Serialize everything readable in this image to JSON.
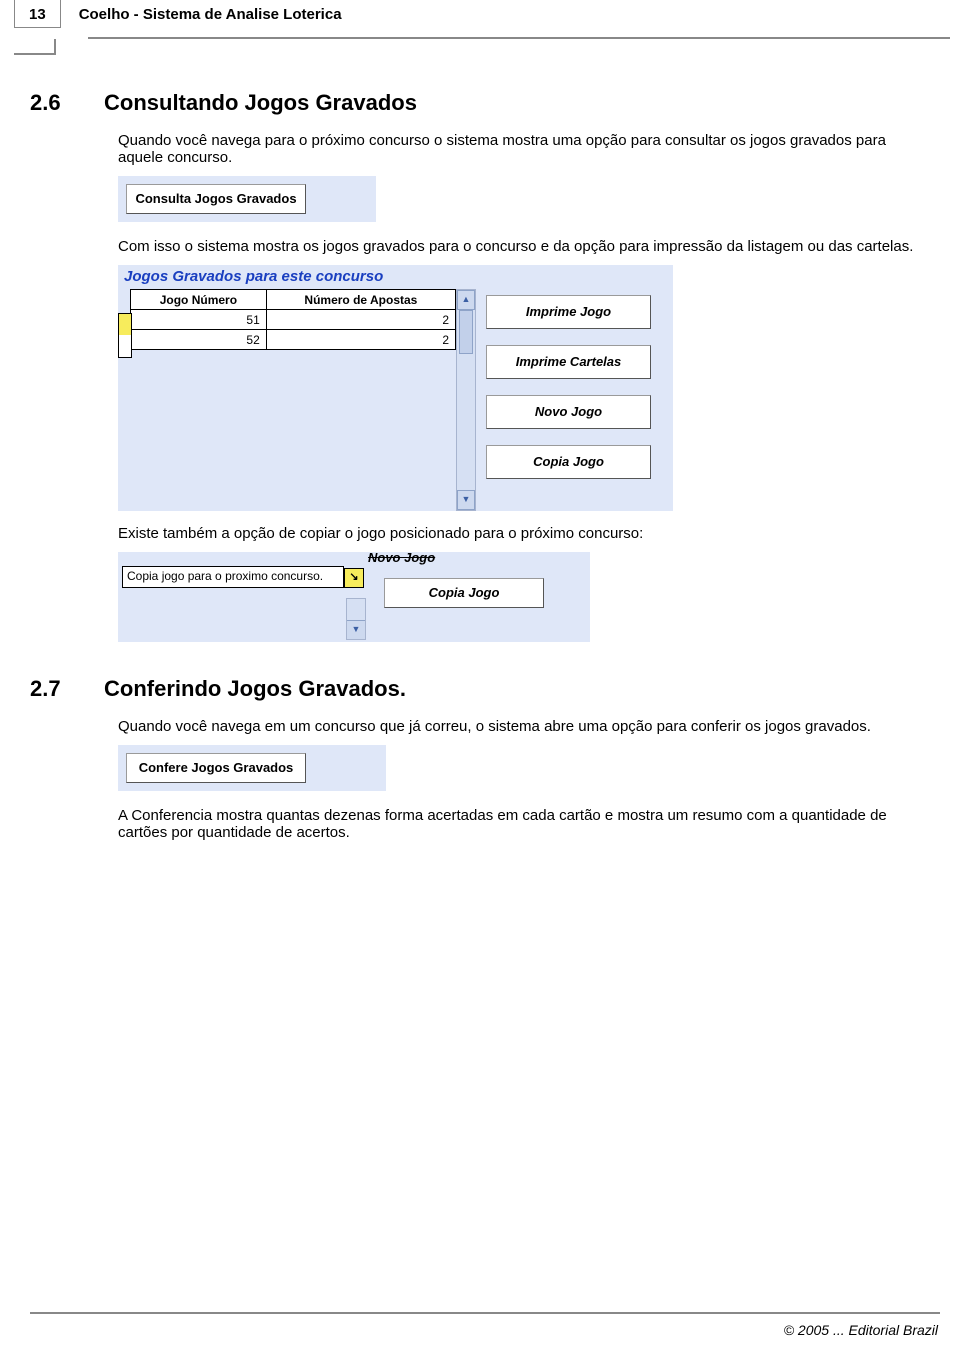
{
  "header": {
    "page_number": "13",
    "doc_title": "Coelho - Sistema de Analise Loterica"
  },
  "section26": {
    "number": "2.6",
    "title": "Consultando Jogos Gravados",
    "para1": "Quando você navega para o próximo concurso o sistema mostra uma opção para consultar os  jogos gravados para aquele concurso.",
    "shot1_button": "Consulta Jogos Gravados",
    "para2": "Com isso o sistema mostra os jogos gravados para o concurso e da opção para impressão da listagem ou das cartelas.",
    "shot2": {
      "panel_title": "Jogos Gravados para este concurso",
      "columns": [
        "Jogo Número",
        "Número de Apostas"
      ],
      "rows": [
        {
          "jogo_numero": 51,
          "numero_apostas": 2
        },
        {
          "jogo_numero": 52,
          "numero_apostas": 2
        }
      ],
      "buttons": [
        "Imprime Jogo",
        "Imprime Cartelas",
        "Novo Jogo",
        "Copia Jogo"
      ]
    },
    "para3": "Existe também a opção de copiar o jogo posicionado para o próximo concurso:",
    "shot3": {
      "cut_title": "Novo Jogo",
      "hint": "Copia jogo para o proximo concurso.",
      "mark": "↘",
      "button": "Copia Jogo"
    }
  },
  "section27": {
    "number": "2.7",
    "title": "Conferindo Jogos Gravados.",
    "para1": "Quando você navega em um concurso que já correu, o sistema abre uma opção para conferir os jogos gravados.",
    "shot4_button": "Confere Jogos Gravados",
    "para2": "A Conferencia mostra quantas dezenas forma acertadas em cada cartão e mostra um resumo com a quantidade de cartões por quantidade de acertos."
  },
  "footer": "© 2005 ... Editorial Brazil"
}
